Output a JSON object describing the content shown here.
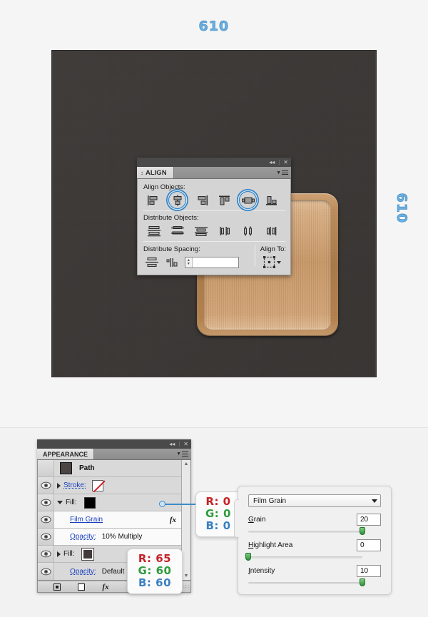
{
  "step": {
    "number_top": "610",
    "number_side": "610",
    "accent_color": "#6aaee0"
  },
  "artwork": {
    "canvas_color": "#3c3836",
    "plaque_name": "wooden-plaque"
  },
  "align_panel": {
    "tab_label": "ALIGN",
    "grip_glyph": "↕",
    "collapse_glyph": "«",
    "close_glyph": "✕",
    "sections": [
      {
        "label": "Align Objects:",
        "buttons": [
          {
            "name": "horizontal-align-left",
            "highlighted": false
          },
          {
            "name": "horizontal-align-center",
            "highlighted": true
          },
          {
            "name": "horizontal-align-right",
            "highlighted": false
          },
          {
            "name": "vertical-align-top",
            "highlighted": false
          },
          {
            "name": "vertical-align-center",
            "highlighted": true
          },
          {
            "name": "vertical-align-bottom",
            "highlighted": false
          }
        ]
      },
      {
        "label": "Distribute Objects:",
        "buttons": [
          {
            "name": "vertical-distribute-top",
            "highlighted": false
          },
          {
            "name": "vertical-distribute-center",
            "highlighted": false
          },
          {
            "name": "vertical-distribute-bottom",
            "highlighted": false
          },
          {
            "name": "horizontal-distribute-left",
            "highlighted": false
          },
          {
            "name": "horizontal-distribute-center",
            "highlighted": false
          },
          {
            "name": "horizontal-distribute-right",
            "highlighted": false
          }
        ]
      }
    ],
    "distribute_spacing": {
      "label": "Distribute Spacing:",
      "buttons": [
        {
          "name": "vertical-distribute-space"
        },
        {
          "name": "horizontal-distribute-space"
        }
      ],
      "value": "",
      "placeholder": ""
    },
    "align_to": {
      "label": "Align To:",
      "value_icon": "align-to-selection-icon"
    }
  },
  "appearance_panel": {
    "tab_label": "APPEARANCE",
    "collapse_glyph": "«",
    "close_glyph": "✕",
    "rows": [
      {
        "type": "header",
        "label": "Path",
        "eye": false,
        "thumb": "path-thumbnail"
      },
      {
        "type": "stroke",
        "label": "Stroke:",
        "eye": true,
        "swatch": "none",
        "disclosure": "collapsed"
      },
      {
        "type": "fill",
        "label": "Fill:",
        "eye": true,
        "swatch": "black",
        "disclosure": "expanded"
      },
      {
        "type": "effect",
        "label": "Film Grain",
        "eye": true,
        "fx": "fx"
      },
      {
        "type": "opacity",
        "label": "Opacity:",
        "value": "10% Multiply",
        "eye": true
      },
      {
        "type": "fill",
        "label": "Fill:",
        "eye": true,
        "swatch": "dark",
        "disclosure": "collapsed"
      },
      {
        "type": "opacity",
        "label": "Opacity:",
        "value": "Default",
        "eye": true
      }
    ],
    "footer_buttons": [
      {
        "name": "add-new-stroke",
        "glyph": "▣"
      },
      {
        "name": "add-new-fill",
        "glyph": "□"
      },
      {
        "name": "add-new-effect",
        "glyph": "fx"
      },
      {
        "name": "clear-appearance",
        "glyph": "⊘"
      }
    ]
  },
  "callouts": [
    {
      "id": "fill-color-top",
      "r_label": "R: 0",
      "g_label": "G: 0",
      "b_label": "B: 0"
    },
    {
      "id": "fill-color-bottom",
      "r_label": "R: 65",
      "g_label": "G: 60",
      "b_label": "B: 60"
    }
  ],
  "film_grain_dialog": {
    "effect_name": "Film Grain",
    "sliders": [
      {
        "label": "Grain",
        "underline_char": "G",
        "value": "20",
        "percent": 100
      },
      {
        "label": "Highlight Area",
        "underline_char": "H",
        "value": "0",
        "percent": 0
      },
      {
        "label": "Intensity",
        "underline_char": "I",
        "value": "10",
        "percent": 100
      }
    ]
  }
}
